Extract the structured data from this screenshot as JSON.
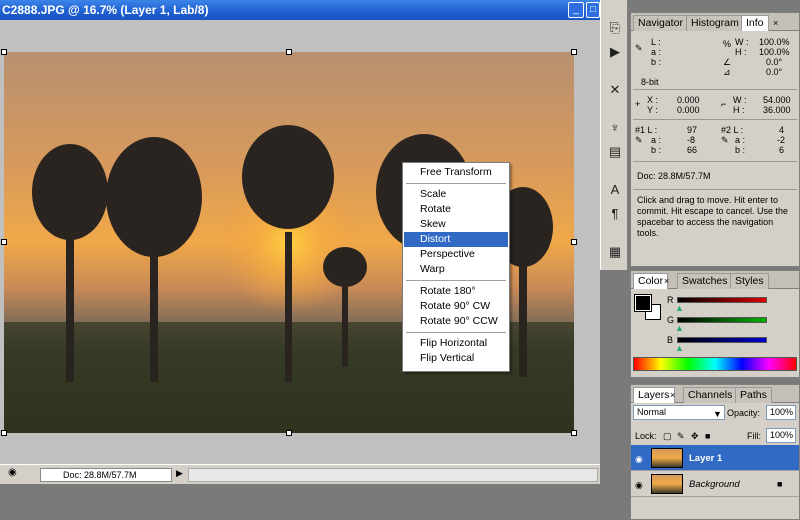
{
  "window": {
    "title": "C2888.JPG @ 16.7% (Layer 1, Lab/8)"
  },
  "status": {
    "doc": "Doc: 28.8M/57.7M"
  },
  "context_menu": {
    "items": [
      "Free Transform",
      "Scale",
      "Rotate",
      "Skew",
      "Distort",
      "Perspective",
      "Warp",
      "Rotate 180°",
      "Rotate 90° CW",
      "Rotate 90° CCW",
      "Flip Horizontal",
      "Flip Vertical"
    ],
    "selected": "Distort"
  },
  "info_panel": {
    "tabs": [
      "Navigator",
      "Histogram",
      "Info"
    ],
    "lab": {
      "L": "L :",
      "a": "a :",
      "b": "b :"
    },
    "pct": {
      "W": "W :",
      "W_val": "100.0%",
      "H": "H :",
      "H_val": "100.0%",
      "A": "0.0°",
      "Hs": "0.0°"
    },
    "bit": "8-bit",
    "x": "X :",
    "x_val": "0.000",
    "y": "Y :",
    "y_val": "0.000",
    "size": {
      "W": "W :",
      "W_val": "54.000",
      "H": "H :",
      "H_val": "36.000"
    },
    "s1": {
      "label": "#1 L :",
      "L": "97",
      "a_label": "a :",
      "a": "-8",
      "b_label": "b :",
      "b": "66"
    },
    "s2": {
      "label": "#2 L :",
      "L": "4",
      "a_label": "a :",
      "a": "-2",
      "b_label": "b :",
      "b": "6"
    },
    "doc": "Doc: 28.8M/57.7M",
    "hint": "Click and drag to move. Hit enter to commit. Hit escape to cancel. Use the spacebar to access the navigation tools."
  },
  "color_panel": {
    "tabs": [
      "Color",
      "Swatches",
      "Styles"
    ],
    "r": "R",
    "g": "G",
    "b": "B",
    "colors": {
      "r": "#e00000",
      "g": "#00b000",
      "b": "#0000d0"
    }
  },
  "layers_panel": {
    "tabs": [
      "Layers",
      "Channels",
      "Paths"
    ],
    "blend_mode": "Normal",
    "opacity_label": "Opacity:",
    "opacity": "100%",
    "lock_label": "Lock:",
    "fill_label": "Fill:",
    "fill": "100%",
    "layers": [
      {
        "name": "Layer 1",
        "selected": true
      },
      {
        "name": "Background",
        "selected": false
      }
    ]
  }
}
